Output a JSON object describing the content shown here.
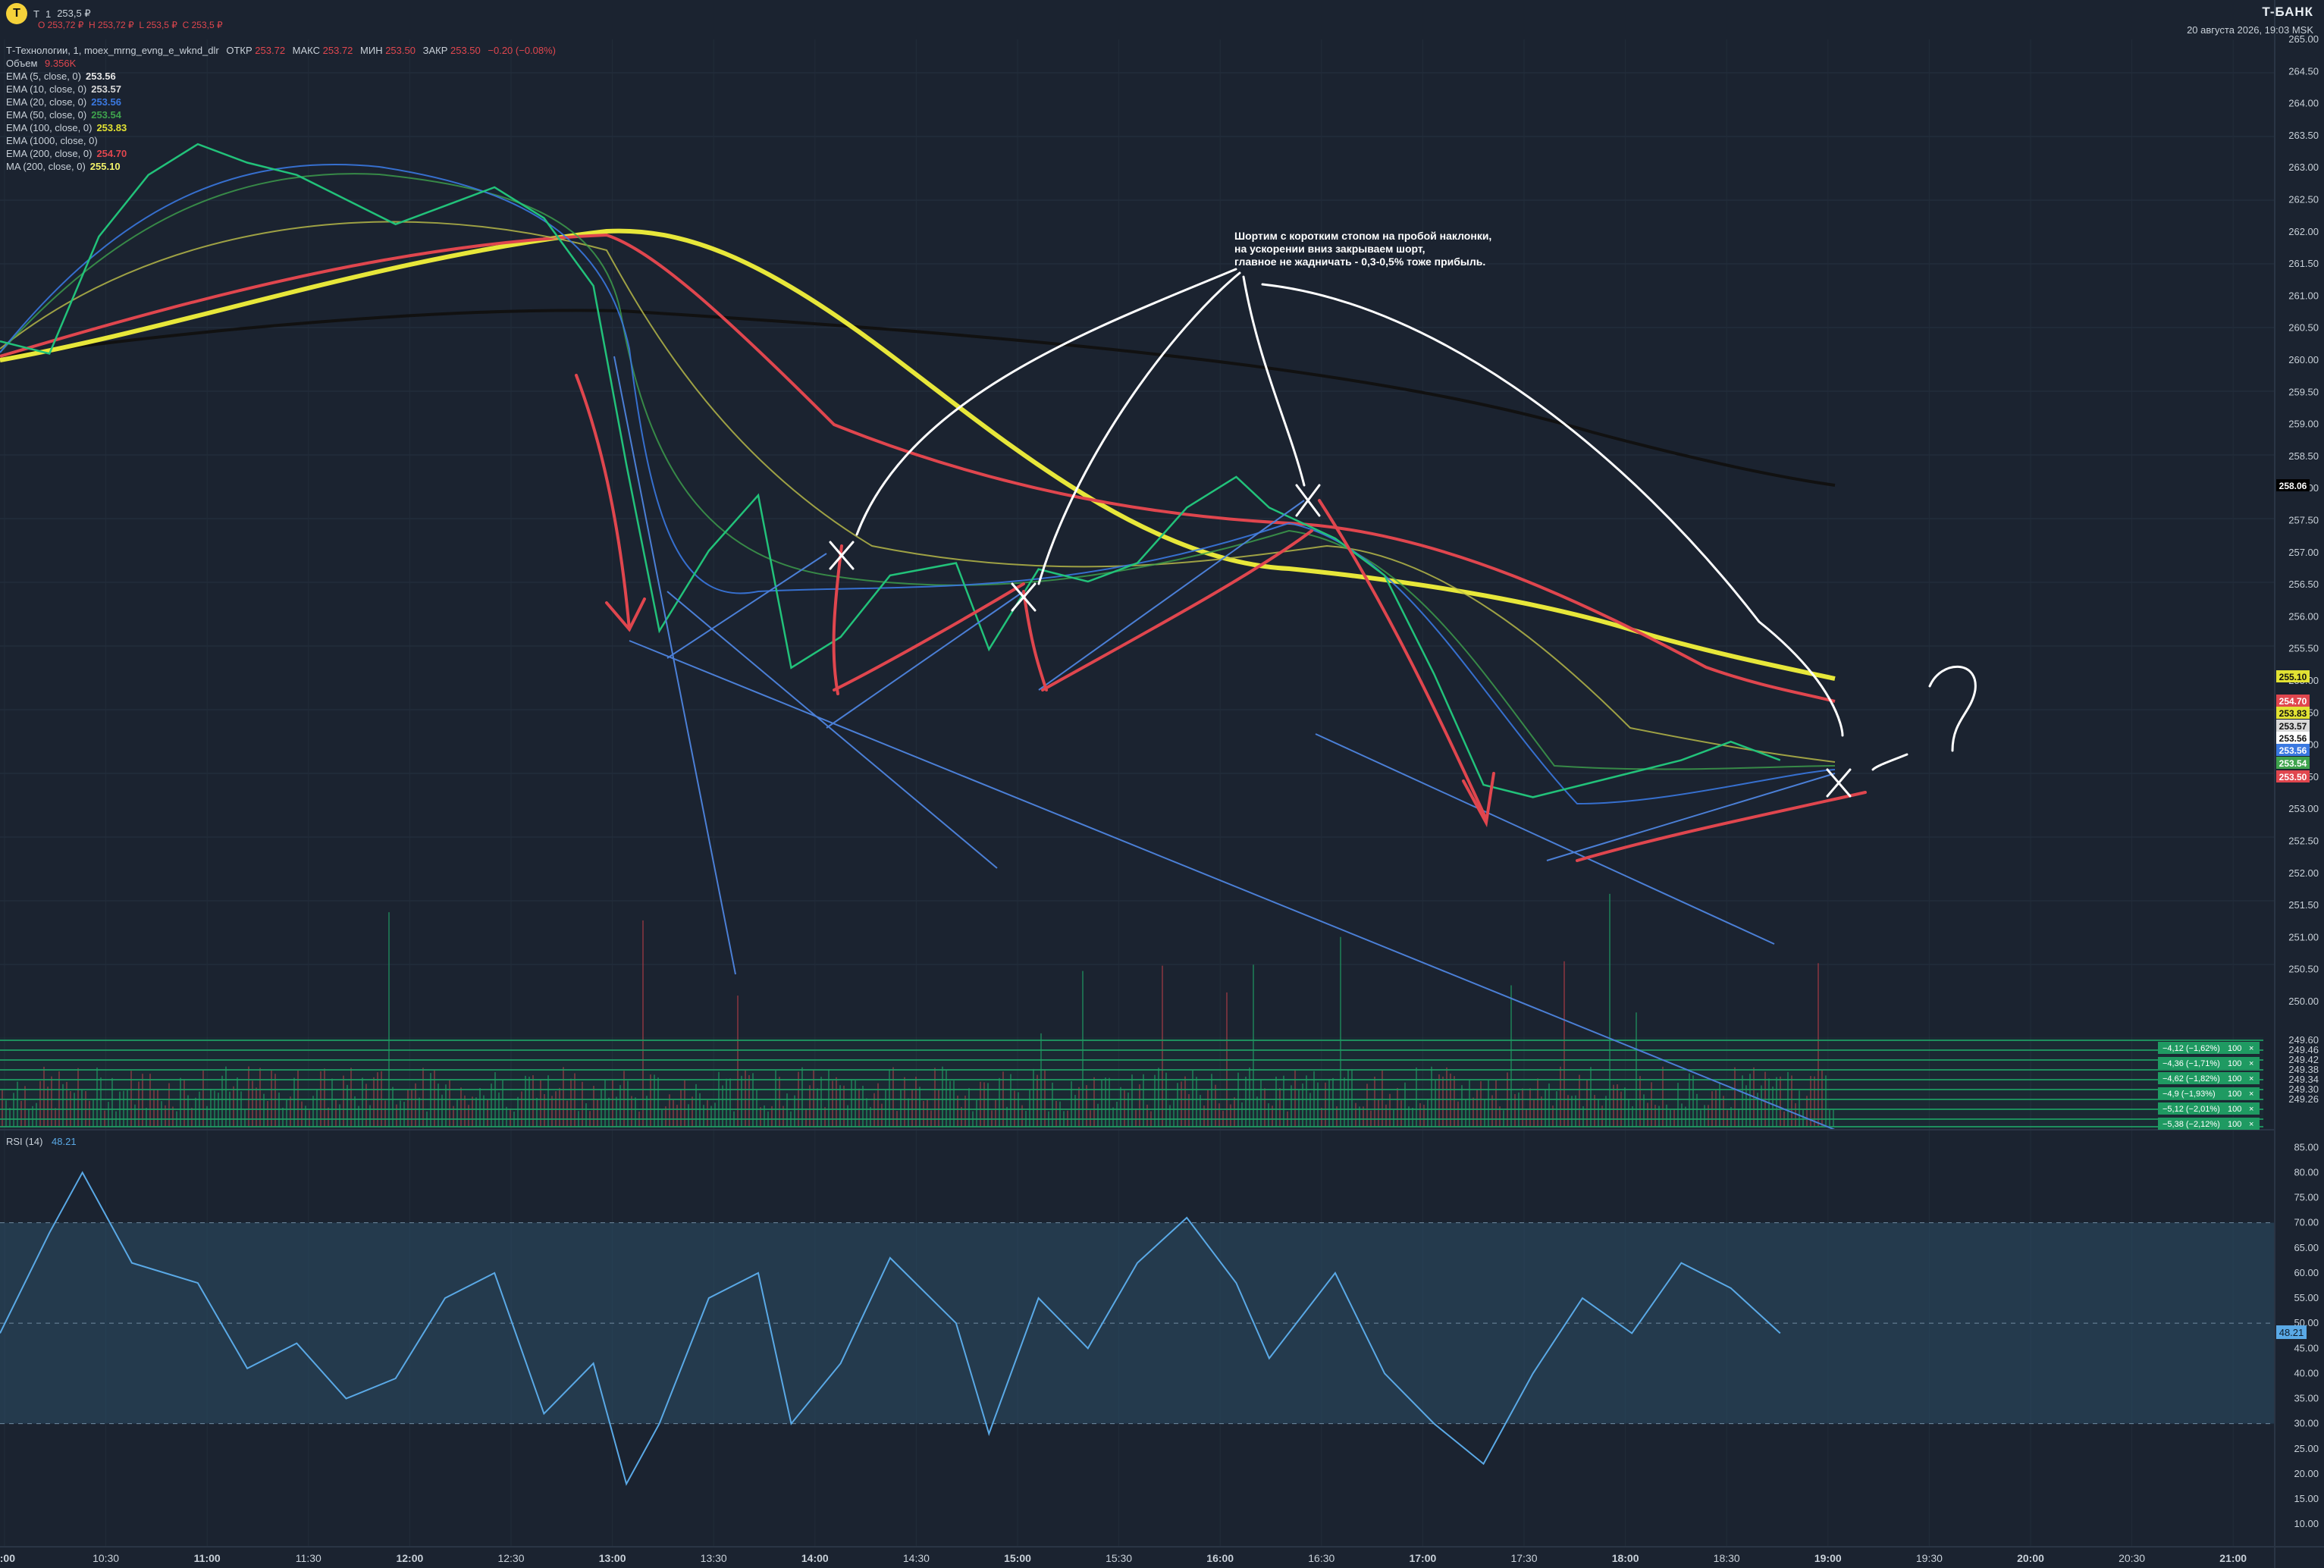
{
  "header": {
    "logo_letter": "Т",
    "ticker": "T",
    "interval": "1",
    "last_price": "253,5 ₽",
    "ohlc": {
      "o": "О 253,72 ₽",
      "h": "Н 253,72 ₽",
      "l": "L 253,5 ₽",
      "c": "С 253,5 ₽"
    }
  },
  "brand": {
    "name": "T-БАНК",
    "date": "20 августа 2026, 19:03 MSK"
  },
  "legend": {
    "symbol": "Т-Технологии, 1, moex_mrng_evng_e_wknd_dlr",
    "open_label": "ОТКР",
    "open_val": "253.72",
    "high_label": "МАКС",
    "high_val": "253.72",
    "low_label": "МИН",
    "low_val": "253.50",
    "close_label": "ЗАКР",
    "close_val": "253.50",
    "change": "−0.20 (−0.08%)",
    "volume_label": "Объем",
    "volume_val": "9.356K",
    "indicators": [
      {
        "label": "EMA (5, close, 0)",
        "value": "253.56",
        "color": "#e6e6e6"
      },
      {
        "label": "EMA (10, close, 0)",
        "value": "253.57",
        "color": "#d9d9d9"
      },
      {
        "label": "EMA (20, close, 0)",
        "value": "253.56",
        "color": "#3a78e0"
      },
      {
        "label": "EMA (50, close, 0)",
        "value": "253.54",
        "color": "#3fa34d"
      },
      {
        "label": "EMA (100, close, 0)",
        "value": "253.83",
        "color": "#e2e233"
      },
      {
        "label": "EMA (1000, close, 0)",
        "value": "",
        "color": "#111111"
      },
      {
        "label": "EMA (200, close, 0)",
        "value": "254.70",
        "color": "#e0464e"
      },
      {
        "label": "MA (200, close, 0)",
        "value": "255.10",
        "color": "#f3f36a"
      }
    ]
  },
  "annotation": {
    "lines": [
      "Шортим с коротким стопом на пробой наклонки,",
      "на ускорении вниз закрываем шорт,",
      "главное не жадничать - 0,3-0,5% тоже прибыль."
    ]
  },
  "rsi": {
    "label": "RSI (14)",
    "value": "48.21"
  },
  "orders": [
    {
      "text": "−4,12 (−1,62%)",
      "qty": "100",
      "price": "249.46"
    },
    {
      "text": "−4,36 (−1,71%)",
      "qty": "100",
      "price": "249.42"
    },
    {
      "text": "−4,62 (−1,82%)",
      "qty": "100",
      "price": "249.38"
    },
    {
      "text": "−4,9 (−1,93%)",
      "qty": "100",
      "price": "249.38"
    },
    {
      "text": "−5,12 (−2,01%)",
      "qty": "100",
      "price": "249.34"
    },
    {
      "text": "−5,38 (−2,12%)",
      "qty": "100",
      "price": "249.30"
    }
  ],
  "price_axis_labels": [
    "265.00",
    "264.50",
    "264.00",
    "263.50",
    "263.00",
    "262.50",
    "262.00",
    "261.50",
    "261.00",
    "260.50",
    "260.00",
    "259.50",
    "259.00",
    "258.50",
    "258.00",
    "257.50",
    "257.00",
    "256.50",
    "256.00",
    "255.50",
    "255.00",
    "254.50",
    "254.00",
    "253.50",
    "253.00",
    "252.50",
    "252.00",
    "251.50",
    "251.00",
    "250.50",
    "250.00",
    "249.60",
    "249.46",
    "249.42",
    "249.38",
    "249.34",
    "249.30",
    "249.26"
  ],
  "badges": [
    {
      "value": "258.06",
      "bg": "#000000",
      "fg": "#ffffff"
    },
    {
      "value": "255.10",
      "bg": "#e2e233",
      "fg": "#111111"
    },
    {
      "value": "254.70",
      "bg": "#e0464e",
      "fg": "#ffffff"
    },
    {
      "value": "253.83",
      "bg": "#e2e233",
      "fg": "#111111"
    },
    {
      "value": "253.57",
      "bg": "#d9d9d9",
      "fg": "#111111"
    },
    {
      "value": "253.56",
      "bg": "#ffffff",
      "fg": "#111111"
    },
    {
      "value": "253.56",
      "bg": "#3a78e0",
      "fg": "#ffffff"
    },
    {
      "value": "253.54",
      "bg": "#3fa34d",
      "fg": "#ffffff"
    },
    {
      "value": "253.50",
      "bg": "#e0464e",
      "fg": "#ffffff"
    }
  ],
  "rsi_axis_labels": [
    "85.00",
    "80.00",
    "75.00",
    "70.00",
    "65.00",
    "60.00",
    "55.00",
    "50.00",
    "45.00",
    "40.00",
    "35.00",
    "30.00",
    "25.00",
    "20.00",
    "15.00",
    "10.00"
  ],
  "time_axis_labels": [
    "0:00",
    "10:30",
    "11:00",
    "11:30",
    "12:00",
    "12:30",
    "13:00",
    "13:30",
    "14:00",
    "14:30",
    "15:00",
    "15:30",
    "16:00",
    "16:30",
    "17:00",
    "17:30",
    "18:00",
    "18:30",
    "19:00",
    "19:30",
    "20:00",
    "20:30",
    "21:00"
  ],
  "chart_data": {
    "type": "line",
    "y_range": [
      249.2,
      265.2
    ],
    "rsi_range": [
      7,
      87
    ],
    "rsi_bands": [
      30,
      50,
      70
    ],
    "x_time_range": [
      "10:00",
      "21:30"
    ],
    "price_path": [
      [
        "10:00",
        260.3
      ],
      [
        "10:15",
        260.1
      ],
      [
        "10:30",
        262.0
      ],
      [
        "10:45",
        263.0
      ],
      [
        "11:00",
        263.5
      ],
      [
        "11:15",
        263.2
      ],
      [
        "11:30",
        263.0
      ],
      [
        "11:45",
        262.6
      ],
      [
        "12:00",
        262.2
      ],
      [
        "12:15",
        262.5
      ],
      [
        "12:30",
        262.8
      ],
      [
        "12:45",
        262.3
      ],
      [
        "13:00",
        261.2
      ],
      [
        "13:10",
        258.3
      ],
      [
        "13:20",
        255.6
      ],
      [
        "13:35",
        256.9
      ],
      [
        "13:50",
        257.8
      ],
      [
        "14:00",
        255.0
      ],
      [
        "14:15",
        255.5
      ],
      [
        "14:30",
        256.5
      ],
      [
        "14:50",
        256.7
      ],
      [
        "15:00",
        255.3
      ],
      [
        "15:15",
        256.6
      ],
      [
        "15:30",
        256.4
      ],
      [
        "15:45",
        256.7
      ],
      [
        "16:00",
        257.6
      ],
      [
        "16:15",
        258.1
      ],
      [
        "16:25",
        257.6
      ],
      [
        "16:45",
        257.1
      ],
      [
        "17:00",
        256.5
      ],
      [
        "17:15",
        254.9
      ],
      [
        "17:30",
        253.1
      ],
      [
        "17:45",
        252.9
      ],
      [
        "18:00",
        253.1
      ],
      [
        "18:15",
        253.3
      ],
      [
        "18:30",
        253.5
      ],
      [
        "18:45",
        253.8
      ],
      [
        "19:00",
        253.5
      ]
    ],
    "rsi_path": [
      [
        "10:00",
        48
      ],
      [
        "10:15",
        68
      ],
      [
        "10:25",
        80
      ],
      [
        "10:40",
        62
      ],
      [
        "11:00",
        58
      ],
      [
        "11:15",
        41
      ],
      [
        "11:30",
        46
      ],
      [
        "11:45",
        35
      ],
      [
        "12:00",
        39
      ],
      [
        "12:15",
        55
      ],
      [
        "12:30",
        60
      ],
      [
        "12:45",
        32
      ],
      [
        "13:00",
        42
      ],
      [
        "13:10",
        18
      ],
      [
        "13:20",
        30
      ],
      [
        "13:35",
        55
      ],
      [
        "13:50",
        60
      ],
      [
        "14:00",
        30
      ],
      [
        "14:15",
        42
      ],
      [
        "14:30",
        63
      ],
      [
        "14:50",
        50
      ],
      [
        "15:00",
        28
      ],
      [
        "15:15",
        55
      ],
      [
        "15:30",
        45
      ],
      [
        "15:45",
        62
      ],
      [
        "16:00",
        71
      ],
      [
        "16:15",
        58
      ],
      [
        "16:25",
        43
      ],
      [
        "16:45",
        60
      ],
      [
        "17:00",
        40
      ],
      [
        "17:15",
        30
      ],
      [
        "17:30",
        22
      ],
      [
        "17:45",
        40
      ],
      [
        "18:00",
        55
      ],
      [
        "18:15",
        48
      ],
      [
        "18:30",
        62
      ],
      [
        "18:45",
        57
      ],
      [
        "19:00",
        48
      ]
    ]
  }
}
